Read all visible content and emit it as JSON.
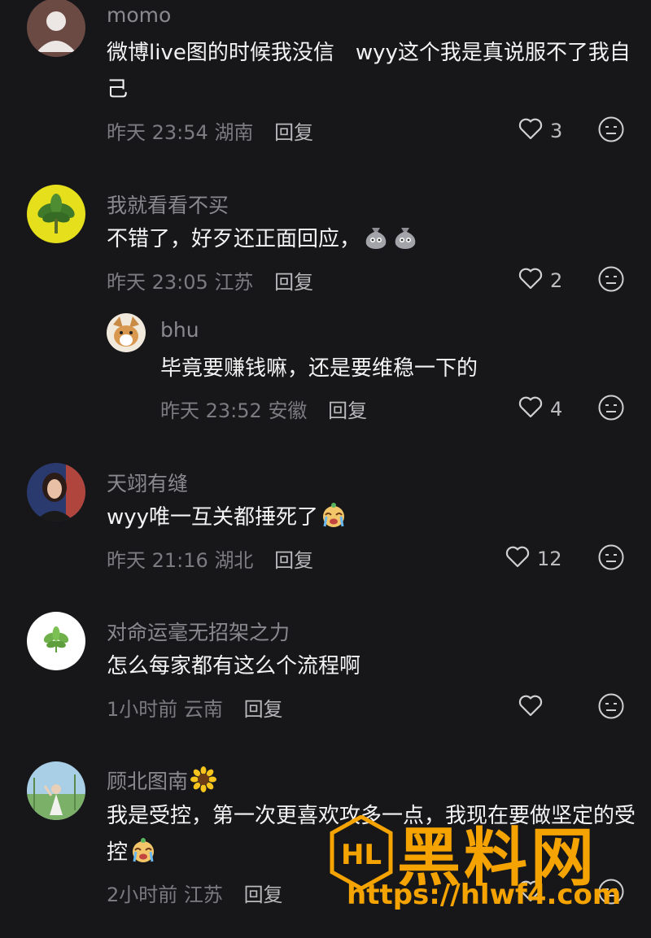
{
  "comments": [
    {
      "username": "momo",
      "text": "微博live图的时候我没信　wyy这个我是真说服不了我自己",
      "time": "昨天 23:54",
      "location": "湖南",
      "reply": "回复",
      "likes": "3"
    },
    {
      "username": "我就看看不买",
      "text": "不错了，好歹还正面回应，",
      "time": "昨天 23:05",
      "location": "江苏",
      "reply": "回复",
      "likes": "2"
    },
    {
      "username": "bhu",
      "text": "毕竟要赚钱嘛，还是要维稳一下的",
      "time": "昨天 23:52",
      "location": "安徽",
      "reply": "回复",
      "likes": "4"
    },
    {
      "username": "天翊有缝",
      "text": "wyy唯一互关都捶死了",
      "time": "昨天 21:16",
      "location": "湖北",
      "reply": "回复",
      "likes": "12"
    },
    {
      "username": "对命运毫无招架之力",
      "text": "怎么每家都有这么个流程啊",
      "time": "1小时前",
      "location": "云南",
      "reply": "回复",
      "likes": ""
    },
    {
      "username": "顾北图南",
      "text": "我是受控，第一次更喜欢攻多一点，我现在要做坚定的受控",
      "time": "2小时前",
      "location": "江苏",
      "reply": "回复",
      "likes": ""
    }
  ],
  "watermark": {
    "title": "黑料网",
    "url": "https://hlwf4.com",
    "logo_text": "HL"
  },
  "icons": {
    "like": "heart-outline-icon",
    "react": "neutral-face-icon",
    "sunflower": "sunflower-emoji",
    "cry": "crying-face-emoji",
    "bag": "money-bag-emoji"
  },
  "colors": {
    "background": "#17171a",
    "accent": "#f4a300"
  }
}
